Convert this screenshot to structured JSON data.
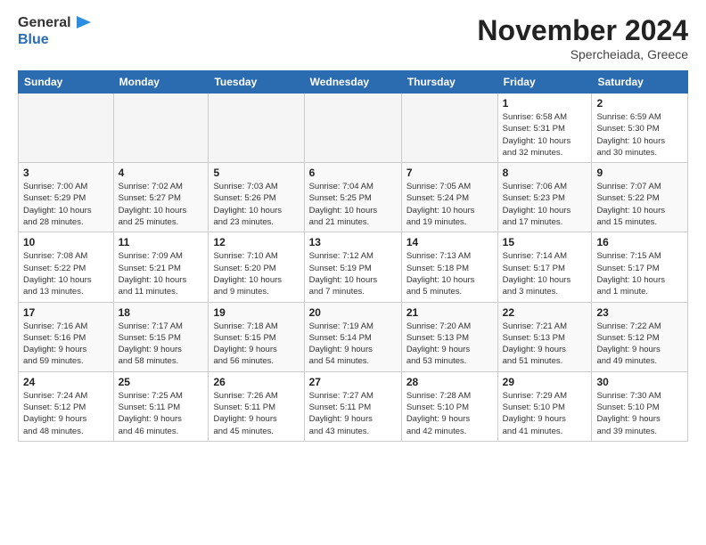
{
  "header": {
    "logo_general": "General",
    "logo_blue": "Blue",
    "month": "November 2024",
    "location": "Spercheiada, Greece"
  },
  "weekdays": [
    "Sunday",
    "Monday",
    "Tuesday",
    "Wednesday",
    "Thursday",
    "Friday",
    "Saturday"
  ],
  "weeks": [
    [
      {
        "day": "",
        "info": ""
      },
      {
        "day": "",
        "info": ""
      },
      {
        "day": "",
        "info": ""
      },
      {
        "day": "",
        "info": ""
      },
      {
        "day": "",
        "info": ""
      },
      {
        "day": "1",
        "info": "Sunrise: 6:58 AM\nSunset: 5:31 PM\nDaylight: 10 hours\nand 32 minutes."
      },
      {
        "day": "2",
        "info": "Sunrise: 6:59 AM\nSunset: 5:30 PM\nDaylight: 10 hours\nand 30 minutes."
      }
    ],
    [
      {
        "day": "3",
        "info": "Sunrise: 7:00 AM\nSunset: 5:29 PM\nDaylight: 10 hours\nand 28 minutes."
      },
      {
        "day": "4",
        "info": "Sunrise: 7:02 AM\nSunset: 5:27 PM\nDaylight: 10 hours\nand 25 minutes."
      },
      {
        "day": "5",
        "info": "Sunrise: 7:03 AM\nSunset: 5:26 PM\nDaylight: 10 hours\nand 23 minutes."
      },
      {
        "day": "6",
        "info": "Sunrise: 7:04 AM\nSunset: 5:25 PM\nDaylight: 10 hours\nand 21 minutes."
      },
      {
        "day": "7",
        "info": "Sunrise: 7:05 AM\nSunset: 5:24 PM\nDaylight: 10 hours\nand 19 minutes."
      },
      {
        "day": "8",
        "info": "Sunrise: 7:06 AM\nSunset: 5:23 PM\nDaylight: 10 hours\nand 17 minutes."
      },
      {
        "day": "9",
        "info": "Sunrise: 7:07 AM\nSunset: 5:22 PM\nDaylight: 10 hours\nand 15 minutes."
      }
    ],
    [
      {
        "day": "10",
        "info": "Sunrise: 7:08 AM\nSunset: 5:22 PM\nDaylight: 10 hours\nand 13 minutes."
      },
      {
        "day": "11",
        "info": "Sunrise: 7:09 AM\nSunset: 5:21 PM\nDaylight: 10 hours\nand 11 minutes."
      },
      {
        "day": "12",
        "info": "Sunrise: 7:10 AM\nSunset: 5:20 PM\nDaylight: 10 hours\nand 9 minutes."
      },
      {
        "day": "13",
        "info": "Sunrise: 7:12 AM\nSunset: 5:19 PM\nDaylight: 10 hours\nand 7 minutes."
      },
      {
        "day": "14",
        "info": "Sunrise: 7:13 AM\nSunset: 5:18 PM\nDaylight: 10 hours\nand 5 minutes."
      },
      {
        "day": "15",
        "info": "Sunrise: 7:14 AM\nSunset: 5:17 PM\nDaylight: 10 hours\nand 3 minutes."
      },
      {
        "day": "16",
        "info": "Sunrise: 7:15 AM\nSunset: 5:17 PM\nDaylight: 10 hours\nand 1 minute."
      }
    ],
    [
      {
        "day": "17",
        "info": "Sunrise: 7:16 AM\nSunset: 5:16 PM\nDaylight: 9 hours\nand 59 minutes."
      },
      {
        "day": "18",
        "info": "Sunrise: 7:17 AM\nSunset: 5:15 PM\nDaylight: 9 hours\nand 58 minutes."
      },
      {
        "day": "19",
        "info": "Sunrise: 7:18 AM\nSunset: 5:15 PM\nDaylight: 9 hours\nand 56 minutes."
      },
      {
        "day": "20",
        "info": "Sunrise: 7:19 AM\nSunset: 5:14 PM\nDaylight: 9 hours\nand 54 minutes."
      },
      {
        "day": "21",
        "info": "Sunrise: 7:20 AM\nSunset: 5:13 PM\nDaylight: 9 hours\nand 53 minutes."
      },
      {
        "day": "22",
        "info": "Sunrise: 7:21 AM\nSunset: 5:13 PM\nDaylight: 9 hours\nand 51 minutes."
      },
      {
        "day": "23",
        "info": "Sunrise: 7:22 AM\nSunset: 5:12 PM\nDaylight: 9 hours\nand 49 minutes."
      }
    ],
    [
      {
        "day": "24",
        "info": "Sunrise: 7:24 AM\nSunset: 5:12 PM\nDaylight: 9 hours\nand 48 minutes."
      },
      {
        "day": "25",
        "info": "Sunrise: 7:25 AM\nSunset: 5:11 PM\nDaylight: 9 hours\nand 46 minutes."
      },
      {
        "day": "26",
        "info": "Sunrise: 7:26 AM\nSunset: 5:11 PM\nDaylight: 9 hours\nand 45 minutes."
      },
      {
        "day": "27",
        "info": "Sunrise: 7:27 AM\nSunset: 5:11 PM\nDaylight: 9 hours\nand 43 minutes."
      },
      {
        "day": "28",
        "info": "Sunrise: 7:28 AM\nSunset: 5:10 PM\nDaylight: 9 hours\nand 42 minutes."
      },
      {
        "day": "29",
        "info": "Sunrise: 7:29 AM\nSunset: 5:10 PM\nDaylight: 9 hours\nand 41 minutes."
      },
      {
        "day": "30",
        "info": "Sunrise: 7:30 AM\nSunset: 5:10 PM\nDaylight: 9 hours\nand 39 minutes."
      }
    ]
  ]
}
